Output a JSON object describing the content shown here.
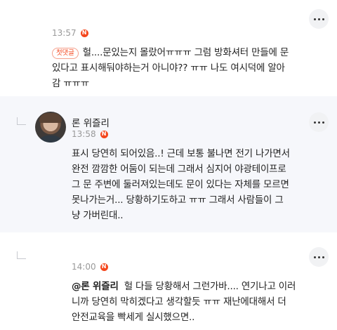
{
  "comments": [
    {
      "time": "13:57",
      "badge": "N",
      "tag": "첫댓글",
      "lines": [
        "헐....문있는지 몰랐어ㅠㅠㅠ 그럼 방화셔터 만들에 문",
        "있다고 표시해둬야하는거 아니야?? ㅠㅠ 나도 여시덕에 알아",
        "감 ㅠㅠㅠ"
      ]
    },
    {
      "name": "론 위즐리",
      "time": "13:58",
      "badge": "N",
      "lines": [
        "표시 당연히 되어있음..! 근데 보통 불나면 전기 나가면서",
        "완전 깜깜한 어둠이 되는데 그래서 심지어 야광테이프로",
        "그 문 주변에 둘러져있는데도 문이 있다는 자체를 모르면",
        "못나가는거... 당황하기도하고 ㅠㅠ 그래서 사람들이 그",
        "냥 가버린대.."
      ]
    },
    {
      "time": "14:00",
      "badge": "N",
      "mention": "@론 위즐리",
      "lines": [
        "헐 다들 당황해서 그런가바.... 연기나고 이러",
        "니까 당연히 막히겠다고 생각할듯 ㅠㅠ 재난에대해서 더",
        "안전교육을 빡세게 실시했으면.."
      ]
    }
  ]
}
